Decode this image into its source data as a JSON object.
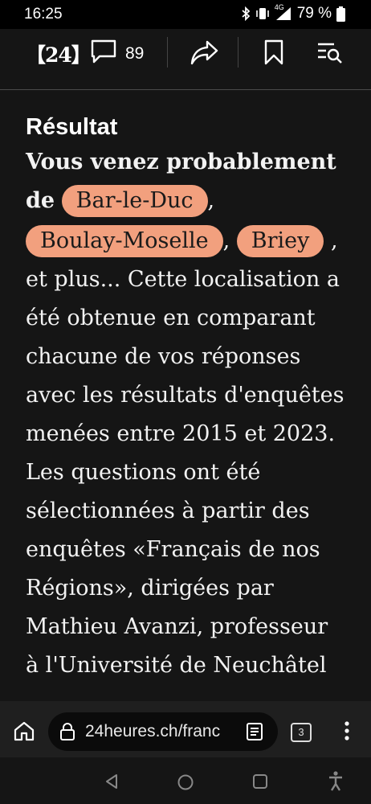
{
  "status_bar": {
    "time": "16:25",
    "network_label": "4G",
    "battery": "79 %",
    "icons": [
      "bluetooth-icon",
      "vibrate-icon",
      "signal-icon",
      "battery-icon"
    ]
  },
  "toolbar": {
    "logo": "【24】",
    "comment_count": "89",
    "icons": [
      "comment-icon",
      "share-icon",
      "bookmark-icon",
      "menu-search-icon"
    ]
  },
  "article": {
    "heading": "Résultat",
    "lead_text": "Vous venez probablement de",
    "pills": [
      "Bar-le-Duc",
      "Boulay-Moselle",
      "Briey"
    ],
    "comma": ",",
    "body": ", et plus... Cette localisation a été obtenue en comparant chacune de vos réponses avec les résultats d'enquêtes menées entre 2015 et 2023. Les questions ont été sélectionnées à partir des enquêtes «Français de nos Régions», dirigées par Mathieu Avanzi, professeur à l'Université de Neuchâtel"
  },
  "browser": {
    "url": "24heures.ch/franc",
    "tab_count": "3",
    "icons": [
      "home-icon",
      "lock-icon",
      "reader-mode-icon",
      "more-icon"
    ]
  },
  "colors": {
    "background": "#151515",
    "pill": "#f2a07e",
    "text": "#f2f2f2"
  }
}
